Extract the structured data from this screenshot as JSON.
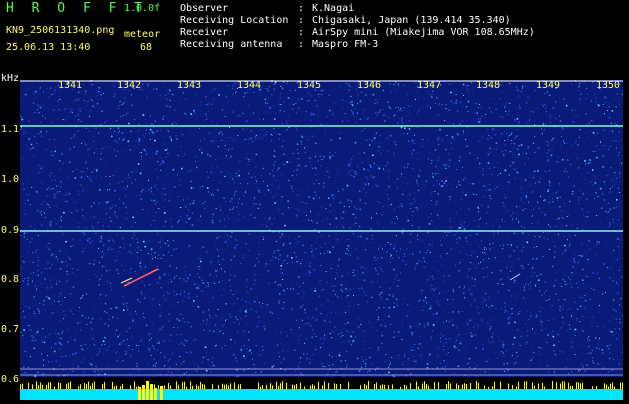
{
  "header": {
    "app_title": "H R O F F T",
    "version": "1.0.0f",
    "filename": "KN9_2506131340.png",
    "meteor_label": "meteor",
    "timestamp": "25.06.13 13:40",
    "meteor_count": "68"
  },
  "info": [
    {
      "key": "Observer",
      "value": "K.Nagai"
    },
    {
      "key": "Receiving Location",
      "value": "Chigasaki, Japan (139.414 35.340)"
    },
    {
      "key": "Receiver",
      "value": "AirSpy mini (Miakejima VOR 108.65MHz)"
    },
    {
      "key": "Receiving antenna",
      "value": "Maspro FM-3"
    }
  ],
  "axis": {
    "y_unit": "kHz",
    "y_ticks": [
      "1.1",
      "1.0",
      "0.9",
      "0.8",
      "0.7",
      "0.6"
    ],
    "x_ticks": [
      "1341",
      "1342",
      "1343",
      "1344",
      "1345",
      "1346",
      "1347",
      "1348",
      "1349",
      "1350"
    ]
  },
  "colors": {
    "background": "#000000",
    "spectrogram_base": "#0a1a78",
    "carrier_line": "#7fffd4",
    "axis_text": "#ffff66",
    "title_text": "#4cff4c",
    "activity_bar": "#00e5ff",
    "activity_peaks": "#ffff00"
  }
}
